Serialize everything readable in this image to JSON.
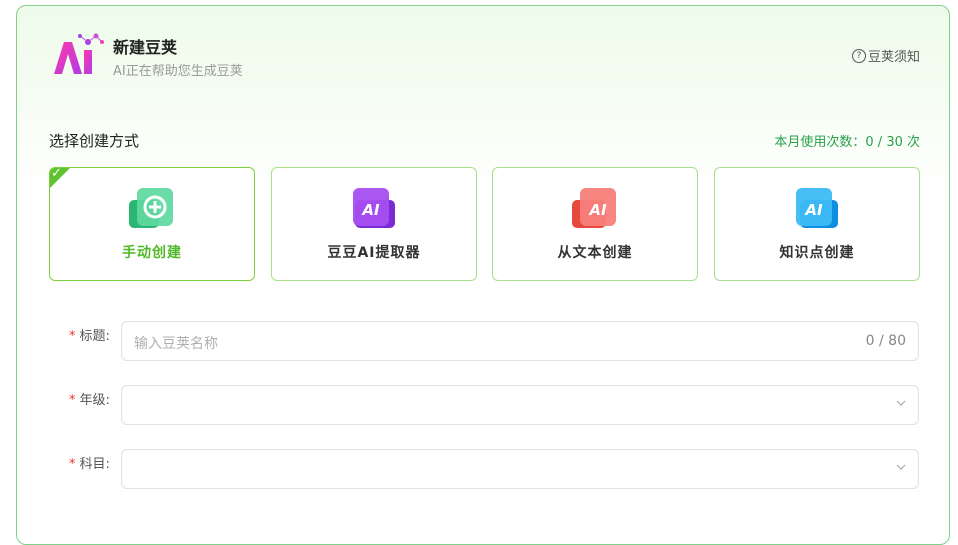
{
  "header": {
    "title": "新建豆荚",
    "subtitle": "AI正在帮助您生成豆荚",
    "help_label": "豆荚须知",
    "logo_text": "AI"
  },
  "create_section": {
    "label": "选择创建方式",
    "usage_text": "本月使用次数：0 / 30 次",
    "cards": [
      {
        "label": "手动创建",
        "icon": "plus-circle-icon",
        "color": "#3fcf8e",
        "selected": true
      },
      {
        "label": "豆豆AI提取器",
        "icon": "ai-purple-icon",
        "color": "#9b3fe6",
        "selected": false
      },
      {
        "label": "从文本创建",
        "icon": "ai-red-icon",
        "color": "#f0605a",
        "selected": false
      },
      {
        "label": "知识点创建",
        "icon": "ai-blue-icon",
        "color": "#1fa3f0",
        "selected": false
      }
    ]
  },
  "form": {
    "title_field": {
      "label": "标题:",
      "placeholder": "输入豆荚名称",
      "counter": "0 / 80",
      "value": ""
    },
    "grade_field": {
      "label": "年级:",
      "value": ""
    },
    "subject_field": {
      "label": "科目:",
      "value": ""
    },
    "required_mark": "*"
  },
  "colors": {
    "accent_green": "#52b82a",
    "border_green": "#7ed08a",
    "required_red": "#e33333"
  }
}
